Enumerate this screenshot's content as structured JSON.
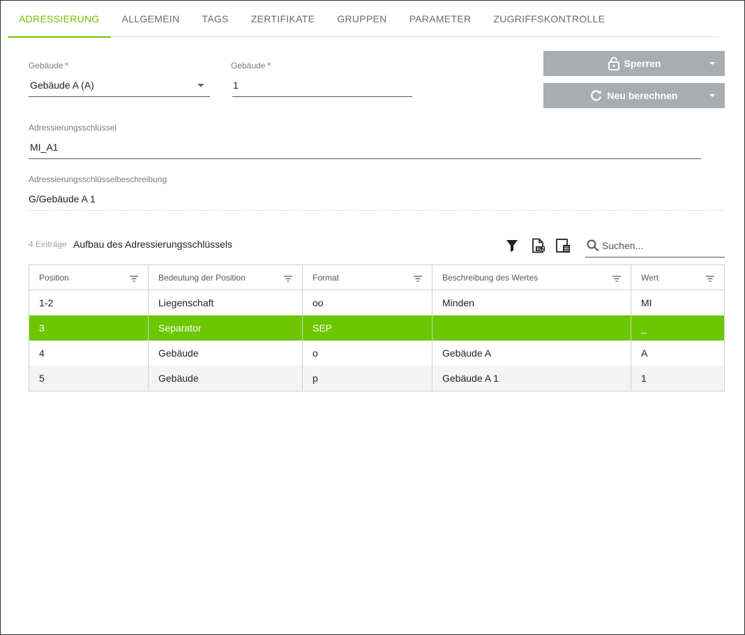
{
  "tabs": [
    {
      "label": "ADRESSIERUNG",
      "active": true
    },
    {
      "label": "ALLGEMEIN",
      "active": false
    },
    {
      "label": "TAGS",
      "active": false
    },
    {
      "label": "ZERTIFIKATE",
      "active": false
    },
    {
      "label": "GRUPPEN",
      "active": false
    },
    {
      "label": "PARAMETER",
      "active": false
    },
    {
      "label": "ZUGRIFFSKONTROLLE",
      "active": false
    }
  ],
  "form": {
    "building_select": {
      "label": "Gebäude",
      "required_mark": "*",
      "value": "Gebäude A (A)"
    },
    "building_number": {
      "label": "Gebäude",
      "required_mark": "*",
      "value": "1"
    },
    "address_key": {
      "label": "Adressierungsschlüssel",
      "value": "MI_A1"
    },
    "address_key_description": {
      "label": "Adressierungsschlüsselbeschreibung",
      "value": "G/Gebäude A 1"
    }
  },
  "actions": {
    "lock": {
      "label": "Sperren",
      "icon": "lock-open-icon"
    },
    "recalculate": {
      "label": "Neu berechnen",
      "icon": "refresh-icon"
    }
  },
  "table_bar": {
    "count": "4 Einträge",
    "title": "Aufbau des Adressierungsschlüssels",
    "search_placeholder": "Suchen...",
    "icons": [
      "filter-icon",
      "xlsx-export-icon",
      "column-chooser-icon",
      "search-icon"
    ]
  },
  "table": {
    "columns": [
      "Position",
      "Bedeutung der Position",
      "Format",
      "Beschreibung des Wertes",
      "Wert"
    ],
    "rows": [
      [
        "1-2",
        "Liegenschaft",
        "oo",
        "Minden",
        "MI"
      ],
      [
        "3",
        "Separator",
        "SEP",
        "",
        "_"
      ],
      [
        "4",
        "Gebäude",
        "o",
        "Gebäude A",
        "A"
      ],
      [
        "5",
        "Gebäude",
        "p",
        "Gebäude A 1",
        "1"
      ]
    ],
    "selected_row": 1
  },
  "colors": {
    "accent": "#6cc700",
    "button": "#a9acb3",
    "required": "#e53935"
  }
}
